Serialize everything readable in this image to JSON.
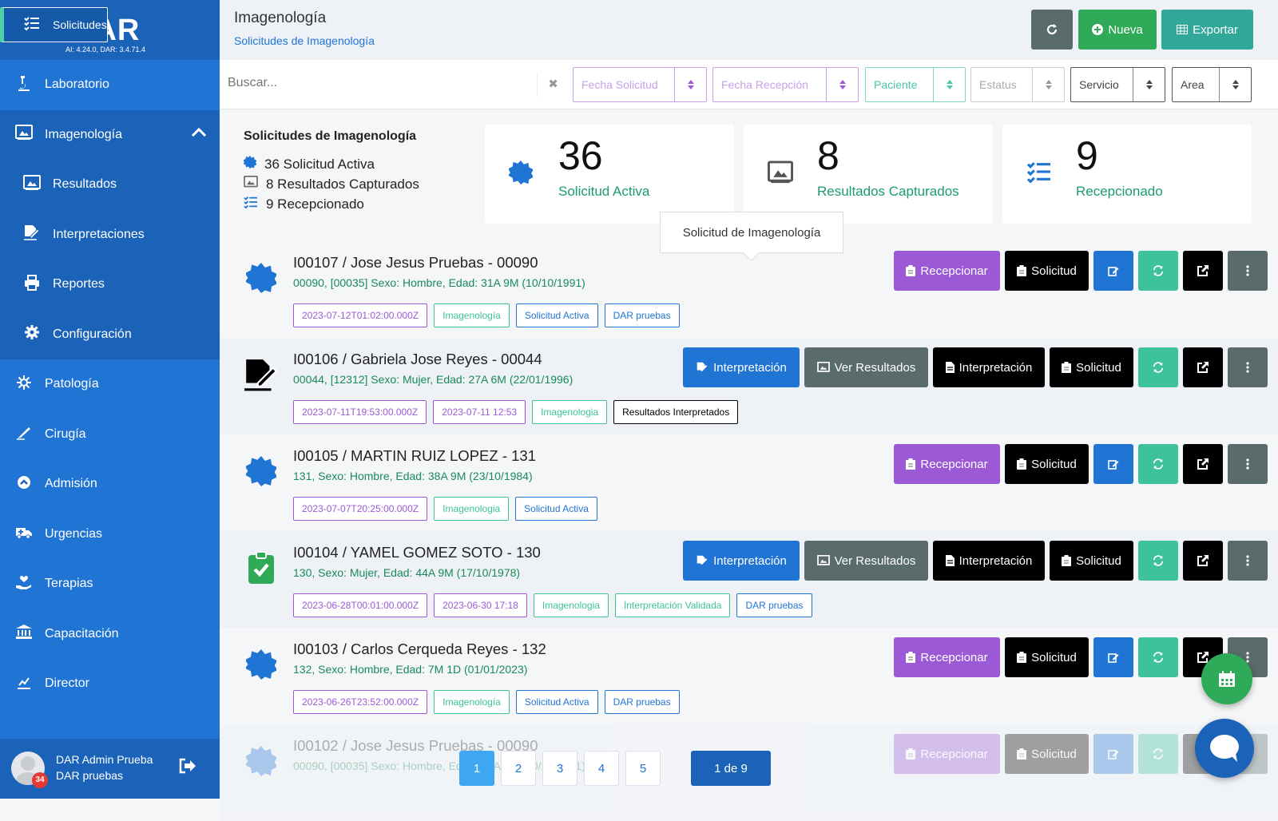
{
  "app": {
    "brand": "DAR",
    "version": "AI: 4.24.0, DAR: 3.4.71.4"
  },
  "sidebar": {
    "items": [
      {
        "label": "Laboratorio",
        "icon": "microscope-icon"
      },
      {
        "label": "Imagenología",
        "icon": "xray-icon"
      },
      {
        "label": "Solicitudes",
        "icon": "list-check-icon"
      },
      {
        "label": "Resultados",
        "icon": "xray-icon"
      },
      {
        "label": "Interpretaciones",
        "icon": "signature-icon"
      },
      {
        "label": "Reportes",
        "icon": "printer-icon"
      },
      {
        "label": "Configuración",
        "icon": "gear-icon"
      },
      {
        "label": "Patología",
        "icon": "virus-icon"
      },
      {
        "label": "Cirugía",
        "icon": "scalpel-icon"
      },
      {
        "label": "Admisión",
        "icon": "arrow-circle-icon"
      },
      {
        "label": "Urgencias",
        "icon": "ambulance-icon"
      },
      {
        "label": "Terapias",
        "icon": "hand-heart-icon"
      },
      {
        "label": "Capacitación",
        "icon": "institution-icon"
      },
      {
        "label": "Director",
        "icon": "chart-icon"
      }
    ]
  },
  "user": {
    "name": "DAR Admin Prueba",
    "org": "DAR pruebas",
    "notifications": "34"
  },
  "header": {
    "title": "Imagenología",
    "breadcrumb": "Solicitudes de Imagenología",
    "nueva": "Nueva",
    "exportar": "Exportar"
  },
  "filters": {
    "search_placeholder": "Buscar...",
    "fecha_solicitud": "Fecha Solicitud",
    "fecha_recepcion": "Fecha Recepción",
    "paciente": "Paciente",
    "estatus": "Estatus",
    "servicio": "Servicio",
    "area": "Area"
  },
  "summary": {
    "title": "Solicitudes de Imagenología",
    "lines": [
      "36 Solicitud Activa",
      "8 Resultados Capturados",
      "9 Recepcionado"
    ]
  },
  "cards": [
    {
      "num": "36",
      "label": "Solicitud Activa"
    },
    {
      "num": "8",
      "label": "Resultados Capturados"
    },
    {
      "num": "9",
      "label": "Recepcionado"
    }
  ],
  "tooltip": "Solicitud de Imagenología",
  "rows": [
    {
      "title": "I00107 / Jose Jesus Pruebas - 00090",
      "sub": "00090, [00035] Sexo: Hombre, Edad: 31A 9M (10/10/1991)",
      "tags": [
        "2023-07-12T01:02:00.000Z",
        "Imagenología",
        "Solicitud Activa",
        "DAR pruebas"
      ]
    },
    {
      "title": "I00106 / Gabriela Jose Reyes - 00044",
      "sub": "00044, [12312] Sexo: Mujer, Edad: 27A 6M (22/01/1996)",
      "tags": [
        "2023-07-11T19:53:00.000Z",
        "2023-07-11 12:53",
        "Imagenologia",
        "Resultados Interpretados"
      ]
    },
    {
      "title": "I00105 / MARTIN RUIZ LOPEZ - 131",
      "sub": "131, Sexo: Hombre, Edad: 38A 9M (23/10/1984)",
      "tags": [
        "2023-07-07T20:25:00.000Z",
        "Imagenologia",
        "Solicitud Activa"
      ]
    },
    {
      "title": "I00104 / YAMEL GOMEZ SOTO - 130",
      "sub": "130, Sexo: Mujer, Edad: 44A 9M (17/10/1978)",
      "tags": [
        "2023-06-28T00:01:00.000Z",
        "2023-06-30 17:18",
        "Imagenologia",
        "Interpretación Validada",
        "DAR pruebas"
      ]
    },
    {
      "title": "I00103 / Carlos Cerqueda Reyes - 132",
      "sub": "132, Sexo: Hombre, Edad: 7M 1D (01/01/2023)",
      "tags": [
        "2023-06-26T23:52:00.000Z",
        "Imagenología",
        "Solicitud Activa",
        "DAR pruebas"
      ]
    },
    {
      "title": "I00102 / Jose Jesus Pruebas - 00090",
      "sub": "00090, [00035] Sexo: Hombre, Edad: 31A 9M (10/10/1991)",
      "tags": []
    }
  ],
  "actions": {
    "recepcionar": "Recepcionar",
    "solicitud": "Solicitud",
    "interpretacion": "Interpretación",
    "ver_resultados": "Ver Resultados"
  },
  "pager": {
    "pages": [
      "1",
      "2",
      "3",
      "4",
      "5"
    ],
    "of": "1 de 9"
  },
  "colors": {
    "sidebar": "#1f74d4",
    "purple": "#9b59d6",
    "green": "#2faa58",
    "teal": "#32a89a",
    "blue": "#1f74d4",
    "grey": "#5a6b6b",
    "black": "#000000",
    "mint": "#3dc29c"
  }
}
